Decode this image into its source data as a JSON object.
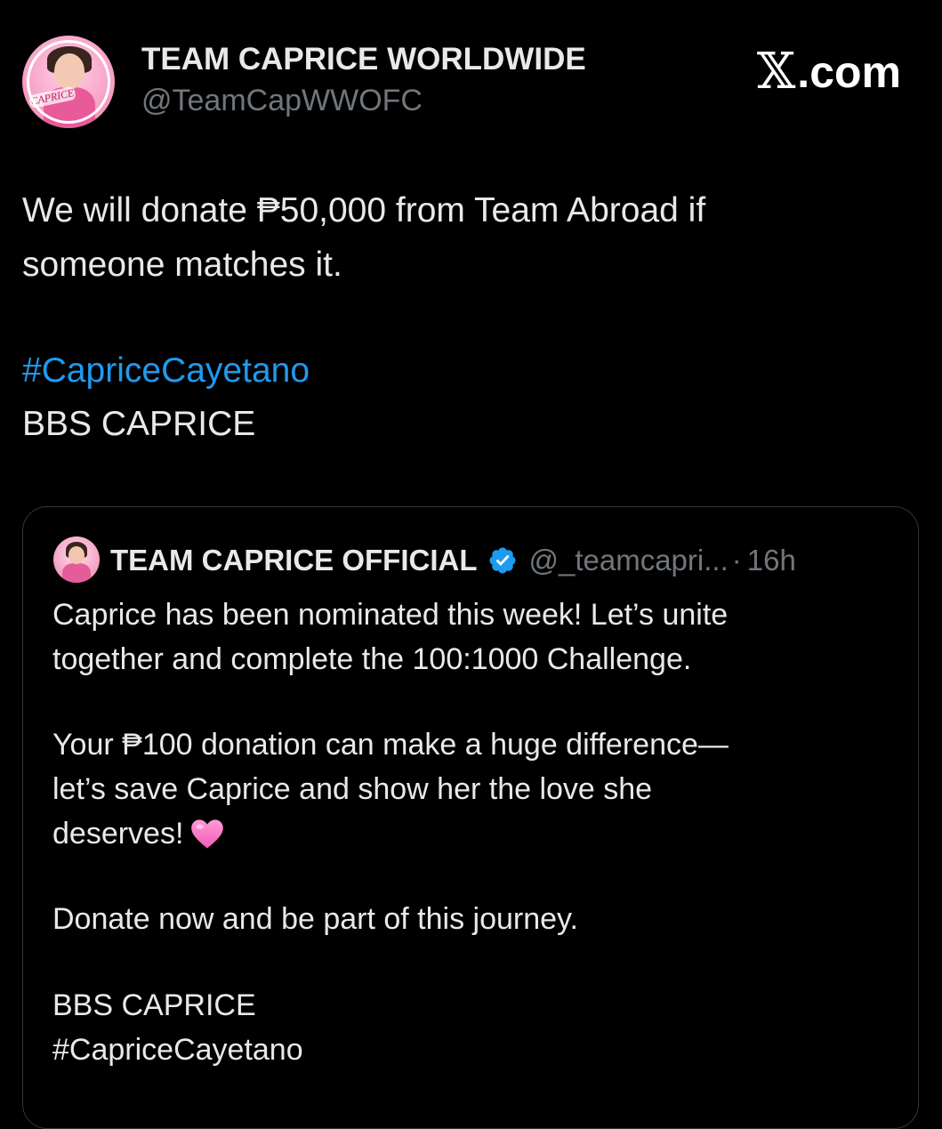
{
  "tweet": {
    "author": {
      "display_name": "TEAM CAPRICE WORLDWIDE",
      "handle": "@TeamCapWWOFC",
      "avatar_text": "CAPRICE"
    },
    "brand": {
      "domain": ".com",
      "icon": "x-logo-icon"
    },
    "text_lines": [
      "We will donate ₱50,000 from Team Abroad if",
      "someone matches it."
    ],
    "hashtag": "#CapriceCayetano",
    "footer_line": "BBS CAPRICE"
  },
  "quoted_tweet": {
    "author": {
      "display_name": "TEAM CAPRICE OFFICIAL",
      "verified_icon": "verified-badge-icon",
      "handle": "@_teamcapri...",
      "separator": "·",
      "time": "16h"
    },
    "lines": {
      "p1_l1": "Caprice has been nominated this week! Let’s unite",
      "p1_l2": "together and complete the 100:1000 Challenge.",
      "p2_l1": "Your ₱100 donation can make a huge difference—",
      "p2_l2": "let’s save Caprice and show her the love she",
      "p2_l3": "deserves!",
      "p3_l1": "Donate now and be part of this journey.",
      "p4_l1": "BBS CAPRICE",
      "p4_l2": "#CapriceCayetano"
    },
    "emoji_icon": "pink-heart-icon"
  },
  "colors": {
    "background": "#000000",
    "text": "#e7e9ea",
    "muted": "#71767b",
    "link": "#1d9bf0",
    "verified": "#1d9bf0",
    "heart": "#f774c4",
    "card_border": "#333639"
  }
}
